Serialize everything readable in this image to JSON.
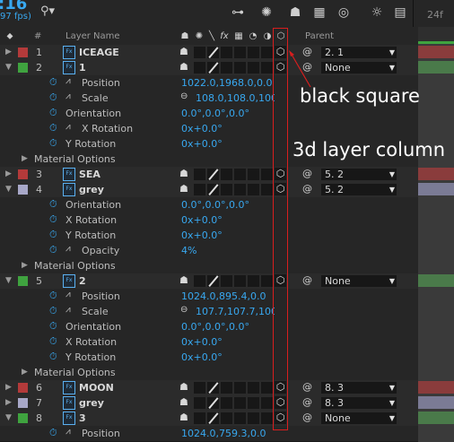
{
  "topbar": {
    "timecode": ":16",
    "fps": "97 fps)",
    "ruler_label": "24f",
    "icons": [
      "search-icon",
      "composition-flowchart-icon",
      "draft-3d-icon",
      "motion-blur-icon",
      "frame-blending-icon",
      "shy-layers-icon",
      "brainstorm-icon",
      "graph-editor-icon"
    ]
  },
  "header": {
    "label_icon": "⬥",
    "number": "#",
    "layer_name": "Layer Name",
    "switches": [
      "shy",
      "collapse",
      "quality",
      "fx",
      "frame-blend",
      "motion-blur",
      "adjustment",
      "3d"
    ],
    "parent": "Parent"
  },
  "rows": [
    {
      "type": "layer",
      "num": "1",
      "name": "ICEAGE",
      "color": "#b33a3a",
      "expanded": false,
      "parent": "2. 1",
      "bar": "#8a3c3c"
    },
    {
      "type": "layer",
      "num": "2",
      "name": "1",
      "color": "#3fa33f",
      "expanded": true,
      "parent": "None",
      "bar": "#4a7a4a"
    },
    {
      "type": "prop",
      "name": "Position",
      "value": "1022.0,1968.0,0.0",
      "stopwatch": true,
      "graph": true
    },
    {
      "type": "prop",
      "name": "Scale",
      "value": "108.0,108.0,100.0",
      "stopwatch": true,
      "graph": true,
      "link": true
    },
    {
      "type": "prop",
      "name": "Orientation",
      "value": "0.0°,0.0°,0.0°",
      "stopwatch": true,
      "graph": false
    },
    {
      "type": "prop",
      "name": "X Rotation",
      "value": "0x+0.0°",
      "stopwatch": true,
      "graph": true
    },
    {
      "type": "prop",
      "name": "Y Rotation",
      "value": "0x+0.0°",
      "stopwatch": true,
      "graph": false
    },
    {
      "type": "group",
      "name": "Material Options"
    },
    {
      "type": "layer",
      "num": "3",
      "name": "SEA",
      "color": "#b33a3a",
      "expanded": false,
      "parent": "5. 2",
      "bar": "#8a3c3c"
    },
    {
      "type": "layer",
      "num": "4",
      "name": "grey",
      "color": "#a8a8c8",
      "expanded": true,
      "parent": "5. 2",
      "bar": "#7b7b95"
    },
    {
      "type": "prop",
      "name": "Orientation",
      "value": "0.0°,0.0°,0.0°",
      "stopwatch": true,
      "graph": false
    },
    {
      "type": "prop",
      "name": "X Rotation",
      "value": "0x+0.0°",
      "stopwatch": true,
      "graph": false
    },
    {
      "type": "prop",
      "name": "Y Rotation",
      "value": "0x+0.0°",
      "stopwatch": true,
      "graph": false
    },
    {
      "type": "prop",
      "name": "Opacity",
      "value": "4%",
      "stopwatch": true,
      "graph": true
    },
    {
      "type": "group",
      "name": "Material Options"
    },
    {
      "type": "layer",
      "num": "5",
      "name": "2",
      "color": "#3fa33f",
      "expanded": true,
      "parent": "None",
      "bar": "#4a7a4a"
    },
    {
      "type": "prop",
      "name": "Position",
      "value": "1024.0,895.4,0.0",
      "stopwatch": true,
      "graph": true
    },
    {
      "type": "prop",
      "name": "Scale",
      "value": "107.7,107.7,100.0",
      "stopwatch": true,
      "graph": true,
      "link": true
    },
    {
      "type": "prop",
      "name": "Orientation",
      "value": "0.0°,0.0°,0.0°",
      "stopwatch": true,
      "graph": false
    },
    {
      "type": "prop",
      "name": "X Rotation",
      "value": "0x+0.0°",
      "stopwatch": true,
      "graph": false
    },
    {
      "type": "prop",
      "name": "Y Rotation",
      "value": "0x+0.0°",
      "stopwatch": true,
      "graph": false
    },
    {
      "type": "group",
      "name": "Material Options"
    },
    {
      "type": "layer",
      "num": "6",
      "name": "MOON",
      "color": "#b33a3a",
      "expanded": false,
      "parent": "8. 3",
      "bar": "#8a3c3c"
    },
    {
      "type": "layer",
      "num": "7",
      "name": "grey",
      "color": "#a8a8c8",
      "expanded": false,
      "parent": "8. 3",
      "bar": "#7b7b95"
    },
    {
      "type": "layer",
      "num": "8",
      "name": "3",
      "color": "#3fa33f",
      "expanded": true,
      "parent": "None",
      "bar": "#4a7a4a"
    },
    {
      "type": "prop",
      "name": "Position",
      "value": "1024.0,759.3,0.0",
      "stopwatch": true,
      "graph": true
    }
  ],
  "annotations": {
    "label1": "black square",
    "label2": "3d layer column",
    "color": "#d81e1e"
  }
}
